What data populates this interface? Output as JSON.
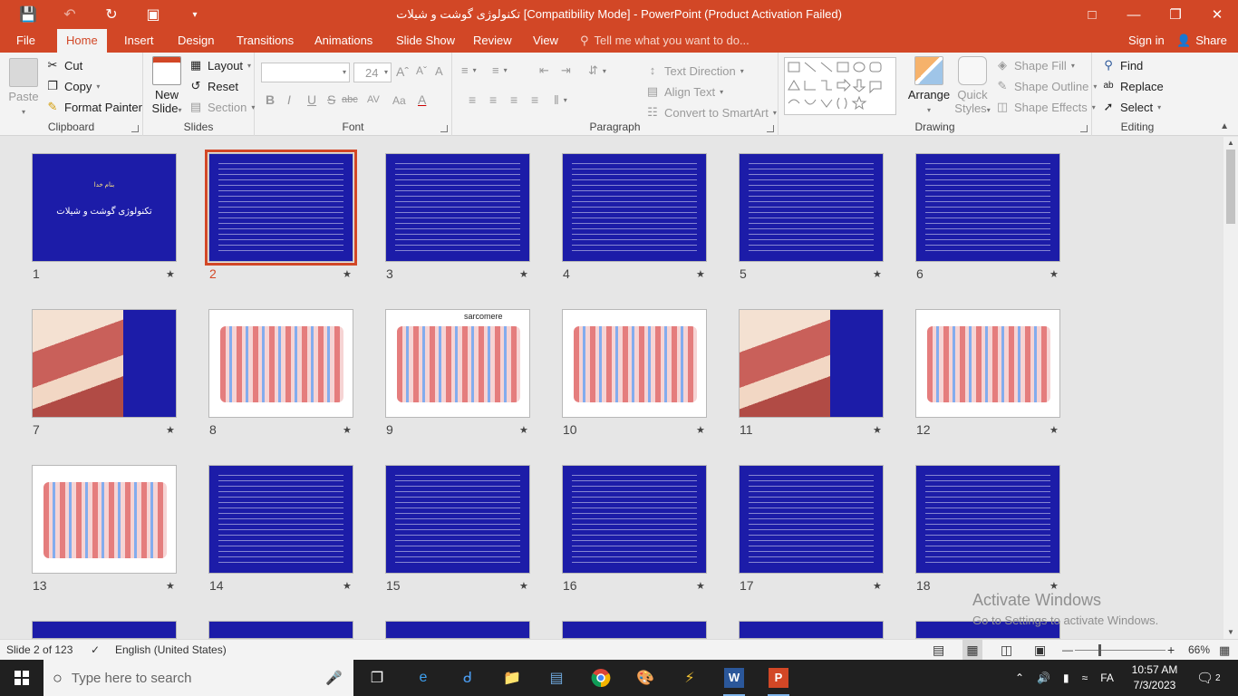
{
  "window": {
    "title": "تکنولوژی گوشت و شیلات [Compatibility Mode] - PowerPoint (Product Activation Failed)"
  },
  "tabs": [
    {
      "label": "File"
    },
    {
      "label": "Home"
    },
    {
      "label": "Insert"
    },
    {
      "label": "Design"
    },
    {
      "label": "Transitions"
    },
    {
      "label": "Animations"
    },
    {
      "label": "Slide Show"
    },
    {
      "label": "Review"
    },
    {
      "label": "View"
    }
  ],
  "tellme": "Tell me what you want to do...",
  "signin": "Sign in",
  "share": "Share",
  "ribbon": {
    "clipboard": {
      "label": "Clipboard",
      "paste": "Paste",
      "cut": "Cut",
      "copy": "Copy",
      "format_painter": "Format Painter"
    },
    "slides": {
      "label": "Slides",
      "new_slide": "New",
      "new_slide2": "Slide",
      "layout": "Layout",
      "reset": "Reset",
      "section": "Section"
    },
    "font": {
      "label": "Font",
      "size": "24",
      "bold": "B",
      "italic": "I",
      "underline": "U",
      "strike": "S",
      "shadow": "abc",
      "spacing": "AV",
      "case": "Aa",
      "clear": "A"
    },
    "paragraph": {
      "label": "Paragraph",
      "text_direction": "Text Direction",
      "align_text": "Align Text",
      "smartart": "Convert to SmartArt"
    },
    "drawing": {
      "label": "Drawing",
      "arrange": "Arrange",
      "quick_styles": "Quick",
      "quick_styles2": "Styles",
      "shape_fill": "Shape Fill",
      "shape_outline": "Shape Outline",
      "shape_effects": "Shape Effects"
    },
    "editing": {
      "label": "Editing",
      "find": "Find",
      "replace": "Replace",
      "select": "Select"
    }
  },
  "slides": [
    {
      "num": "1",
      "style": "blue-title",
      "title": "تکنولوژی گوشت و شیلات",
      "subtitle": "بنام خدا"
    },
    {
      "num": "2",
      "style": "blue-text",
      "selected": true
    },
    {
      "num": "3",
      "style": "blue-text"
    },
    {
      "num": "4",
      "style": "blue-text"
    },
    {
      "num": "5",
      "style": "blue-text"
    },
    {
      "num": "6",
      "style": "blue-text"
    },
    {
      "num": "7",
      "style": "image-blue"
    },
    {
      "num": "8",
      "style": "image"
    },
    {
      "num": "9",
      "style": "image",
      "label": "sarcomere"
    },
    {
      "num": "10",
      "style": "image"
    },
    {
      "num": "11",
      "style": "image-blue"
    },
    {
      "num": "12",
      "style": "image"
    },
    {
      "num": "13",
      "style": "image"
    },
    {
      "num": "14",
      "style": "blue-text"
    },
    {
      "num": "15",
      "style": "blue-text"
    },
    {
      "num": "16",
      "style": "blue-text"
    },
    {
      "num": "17",
      "style": "blue-text"
    },
    {
      "num": "18",
      "style": "blue-text"
    }
  ],
  "watermark": {
    "line1": "Activate Windows",
    "line2": "Go to Settings to activate Windows."
  },
  "status": {
    "slide": "Slide 2 of 123",
    "language": "English (United States)",
    "zoom": "66%"
  },
  "taskbar": {
    "search_placeholder": "Type here to search",
    "lang": "FA",
    "time": "10:57 AM",
    "date": "7/3/2023",
    "notifications": "2"
  }
}
